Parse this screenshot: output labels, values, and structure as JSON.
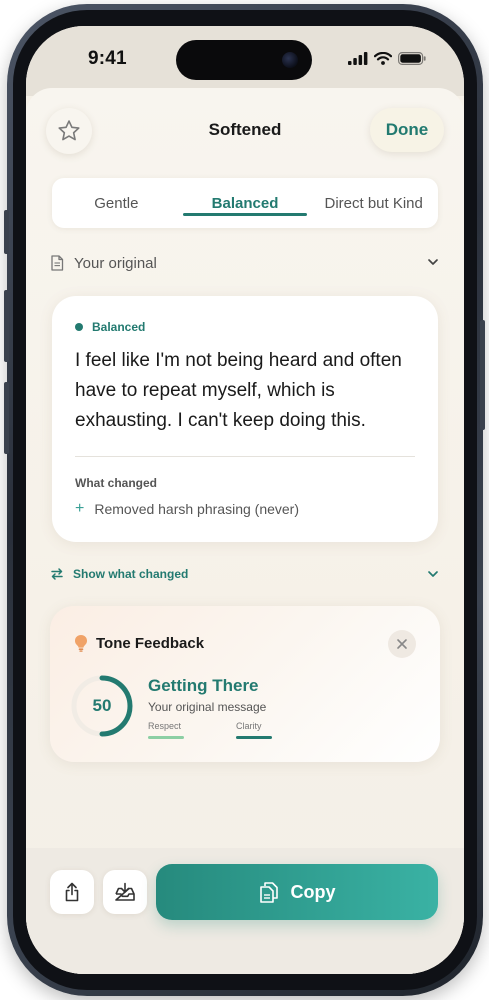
{
  "status_bar": {
    "time": "9:41"
  },
  "header": {
    "title": "Softened",
    "done_label": "Done"
  },
  "tones": {
    "tabs": [
      "Gentle",
      "Balanced",
      "Direct but Kind"
    ],
    "selected": "Balanced"
  },
  "original": {
    "label": "Your original"
  },
  "result": {
    "tone_label": "Balanced",
    "text": "I feel like I'm not being heard and often have to repeat myself, which is exhausting. I can't keep doing this.",
    "changes_heading": "What changed",
    "changes": [
      "Removed harsh phrasing (never)"
    ]
  },
  "show_changed": {
    "label": "Show what changed"
  },
  "tone_feedback": {
    "title": "Tone Feedback",
    "score": "50",
    "status": "Getting There",
    "subtitle": "Your original message",
    "metrics": [
      {
        "label": "Respect",
        "color": "#8ccfa4"
      },
      {
        "label": "Clarity",
        "color": "#237a70"
      }
    ]
  },
  "actions": {
    "copy_label": "Copy"
  },
  "colors": {
    "accent": "#237a70",
    "accent_light": "#3ab2a4",
    "background": "#f6f1e8",
    "bulb": "#f0a267"
  },
  "icons": {
    "star": "star-icon",
    "document": "document-icon",
    "chevron": "chevron-down-icon",
    "swap": "swap-icon",
    "bulb": "lightbulb-icon",
    "close": "close-icon",
    "share": "share-icon",
    "save": "inbox-download-icon",
    "copy": "copy-icon"
  }
}
